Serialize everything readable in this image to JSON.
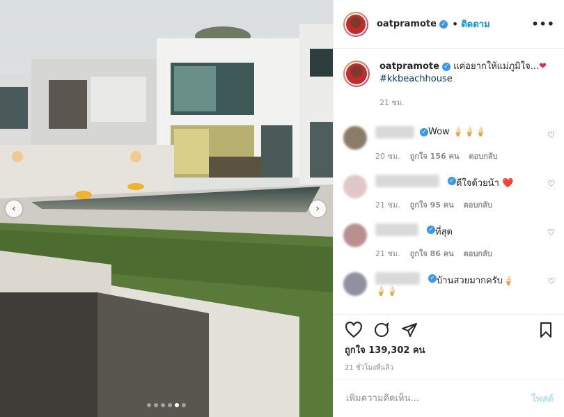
{
  "header": {
    "username": "oatpramote",
    "separator": "•",
    "follow_label": "ติดตาม",
    "more_label": "•••"
  },
  "caption": {
    "username": "oatpramote",
    "text": "แค่อยากให้แม่ภูมิใจ...",
    "hashtag": "#kkbeachhouse",
    "time": "21 ชม."
  },
  "comments": [
    {
      "text": "Wow 🍦🍦🍦",
      "time": "20 ชม.",
      "likes": "ถูกใจ 156 คน",
      "reply": "ตอบกลับ",
      "avatar_color": "#8a7c68"
    },
    {
      "text": "ดีใจด้วยน้า ❤️",
      "time": "21 ชม.",
      "likes": "ถูกใจ 95 คน",
      "reply": "ตอบกลับ",
      "avatar_color": "#e0c8c8"
    },
    {
      "text": "ที่สุด",
      "time": "21 ชม.",
      "likes": "ถูกใจ 86 คน",
      "reply": "ตอบกลับ",
      "avatar_color": "#b89090"
    },
    {
      "text": "บ้านสวยมากครับ🍦",
      "text2": "🍦🍦",
      "time": "",
      "likes": "",
      "reply": "",
      "avatar_color": "#9090a0"
    }
  ],
  "actions": {
    "likes_text": "ถูกใจ 139,302 คน",
    "time_ago": "21 ชั่วโมงที่แล้ว"
  },
  "add_comment": {
    "placeholder": "เพิ่มความคิดเห็น...",
    "post_label": "โพสต์"
  },
  "media": {
    "prev_icon": "‹",
    "next_icon": "›",
    "dot_count": 6,
    "active_dot": 4
  },
  "icons": {
    "verified": "verified-badge",
    "heart": "heart-icon",
    "comment": "comment-icon",
    "share": "share-icon",
    "bookmark": "bookmark-icon"
  }
}
